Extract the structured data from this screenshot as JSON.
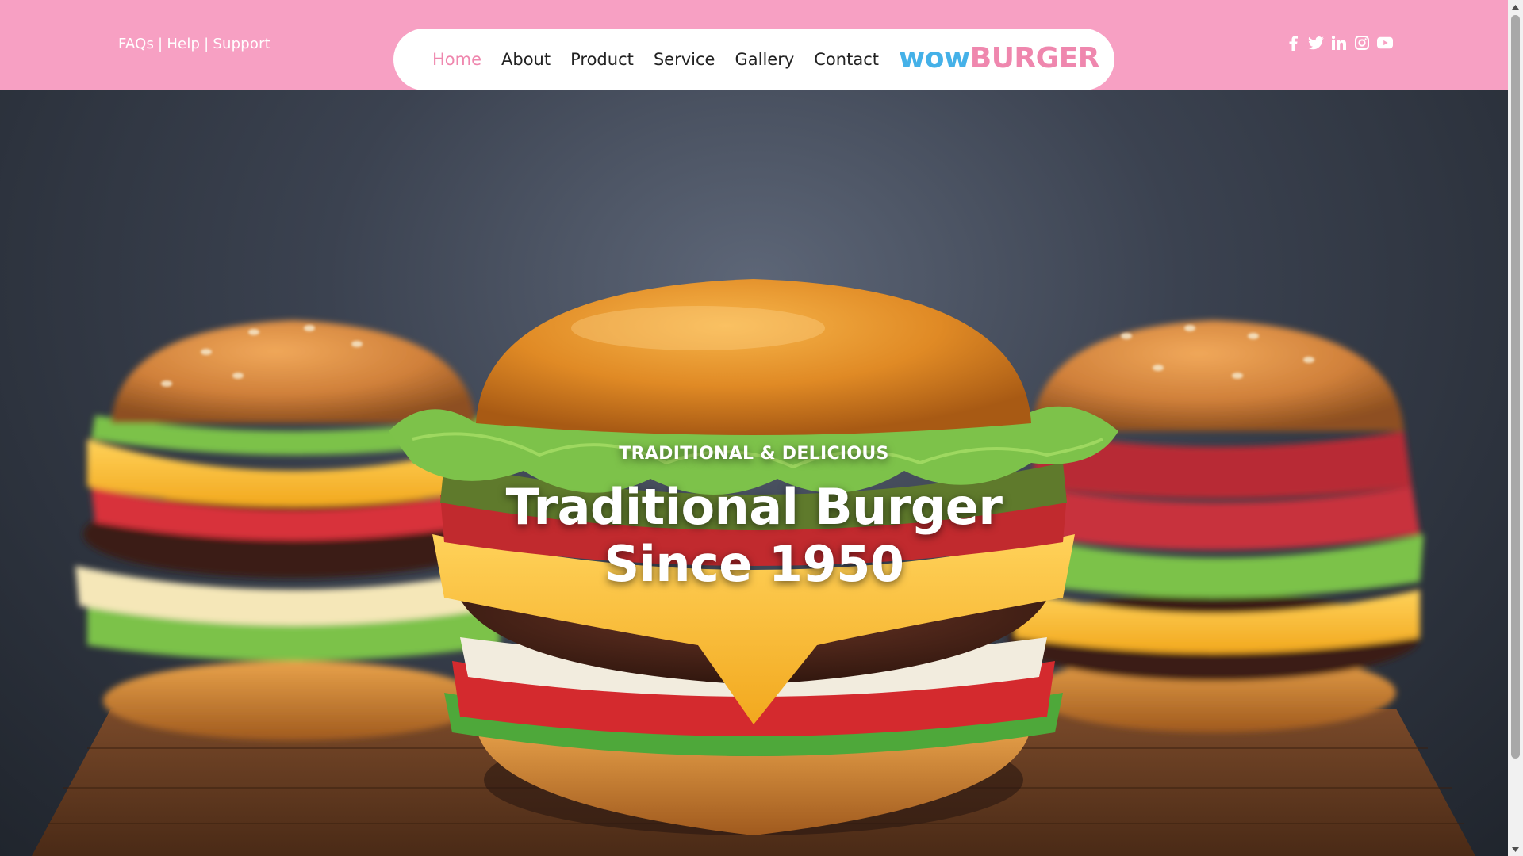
{
  "topbar": {
    "links": [
      {
        "label": "FAQs"
      },
      {
        "label": "Help"
      },
      {
        "label": "Support"
      }
    ],
    "separator": "|",
    "background_color": "#f7a0c3"
  },
  "nav": {
    "items": [
      {
        "label": "Home",
        "active": true
      },
      {
        "label": "About"
      },
      {
        "label": "Product"
      },
      {
        "label": "Service"
      },
      {
        "label": "Gallery"
      },
      {
        "label": "Contact"
      }
    ],
    "active_color": "#ef87ae"
  },
  "logo": {
    "part1": "wow",
    "part2": "BURGER",
    "color1": "#45b1e8",
    "color2": "#ef87ae"
  },
  "social": [
    {
      "icon": "facebook-icon"
    },
    {
      "icon": "twitter-icon"
    },
    {
      "icon": "linkedin-icon"
    },
    {
      "icon": "instagram-icon"
    },
    {
      "icon": "youtube-icon"
    }
  ],
  "hero": {
    "eyebrow": "TRADITIONAL & DELICIOUS",
    "title_line1": "Traditional Burger",
    "title_line2": "Since 1950",
    "image": "photo of three cheeseburgers on a wooden board"
  }
}
